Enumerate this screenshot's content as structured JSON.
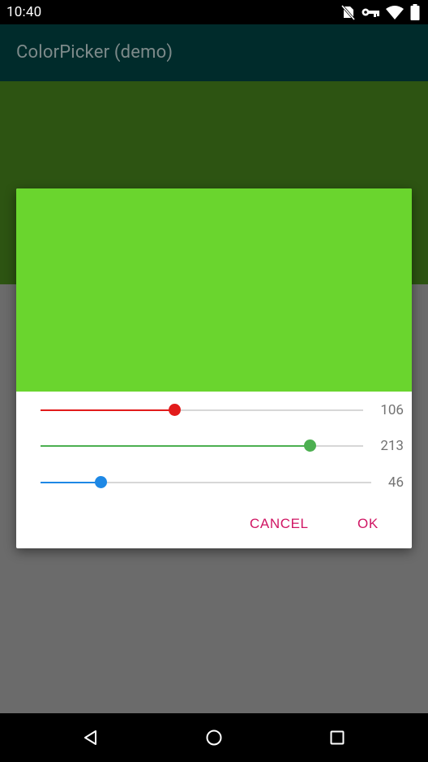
{
  "status_bar": {
    "time": "10:40",
    "icons": [
      "no-sim-icon",
      "vpn-key-icon",
      "wifi-icon",
      "battery-icon"
    ]
  },
  "app_bar": {
    "title": "ColorPicker (demo)"
  },
  "background": {
    "current_color": "#2d5412"
  },
  "dialog": {
    "preview_color": "#6ad52e",
    "sliders": [
      {
        "channel": "red",
        "value": "106",
        "max": 255,
        "color": "#e21b1b"
      },
      {
        "channel": "green",
        "value": "213",
        "max": 255,
        "color": "#4caf50"
      },
      {
        "channel": "blue",
        "value": "46",
        "max": 255,
        "color": "#1e88e5"
      }
    ],
    "cancel_label": "CANCEL",
    "ok_label": "OK",
    "button_color": "#d01563"
  },
  "nav_bar": {
    "icons": [
      "back-icon",
      "home-icon",
      "recents-icon"
    ]
  }
}
